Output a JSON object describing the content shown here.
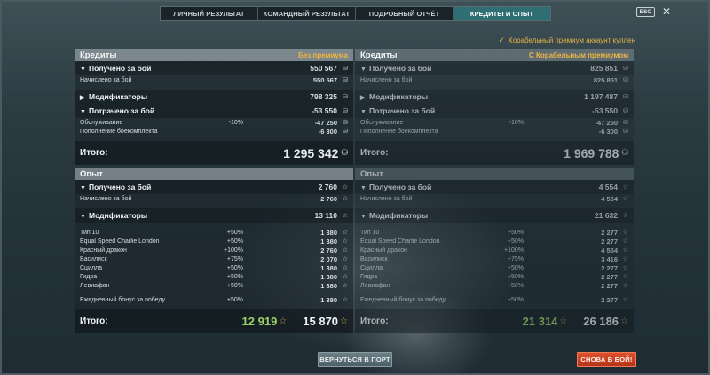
{
  "tabs": [
    {
      "label": "ЛИЧНЫЙ РЕЗУЛЬТАТ",
      "active": false
    },
    {
      "label": "КОМАНДНЫЙ РЕЗУЛЬТАТ",
      "active": false
    },
    {
      "label": "ПОДРОБНЫЙ ОТЧЁТ",
      "active": false
    },
    {
      "label": "КРЕДИТЫ И ОПЫТ",
      "active": true
    }
  ],
  "esc_label": "ESC",
  "premium_note": "Корабельный премиум аккаунт куплен",
  "left": {
    "credits_title": "Кредиты",
    "credits_badge": "Без премиума",
    "earned_label": "Получено за бой",
    "earned_value": "550 567",
    "accrued_label": "Начислено за бой",
    "accrued_value": "550 567",
    "modifiers_label": "Модификаторы",
    "modifiers_value": "798 325",
    "spent_label": "Потрачено за бой",
    "spent_value": "-53 550",
    "service_label": "Обслуживание",
    "service_pct": "-10%",
    "service_value": "-47 250",
    "ammo_label": "Пополнение боекомплекта",
    "ammo_value": "-6 300",
    "total_label": "Итого:",
    "total_value": "1 295 342",
    "xp_title": "Опыт",
    "xp_earned_label": "Получено за бой",
    "xp_earned_value": "2 760",
    "xp_accrued_label": "Начислено за бой",
    "xp_accrued_value": "2 760",
    "xp_mod_label": "Модификаторы",
    "xp_mod_value": "13 110",
    "xp_items": [
      {
        "name": "Тип 10",
        "pct": "+50%",
        "value": "1 380"
      },
      {
        "name": "Equal Speed Charlie London",
        "pct": "+50%",
        "value": "1 380"
      },
      {
        "name": "Красный дракон",
        "pct": "+100%",
        "value": "2 760"
      },
      {
        "name": "Василиск",
        "pct": "+75%",
        "value": "2 070"
      },
      {
        "name": "Сцилла",
        "pct": "+50%",
        "value": "1 380"
      },
      {
        "name": "Гидра",
        "pct": "+50%",
        "value": "1 380"
      },
      {
        "name": "Левиафан",
        "pct": "+50%",
        "value": "1 380"
      }
    ],
    "daily_label": "Ежедневный бонус за победу",
    "daily_pct": "+50%",
    "daily_value": "1 380",
    "xp_total_label": "Итого:",
    "xp_total_free": "12 919",
    "xp_total": "15 870"
  },
  "right": {
    "credits_title": "Кредиты",
    "credits_badge": "С Корабельным премиумом",
    "earned_label": "Получено за бой",
    "earned_value": "825 851",
    "accrued_label": "Начислено за бой",
    "accrued_value": "825 851",
    "modifiers_label": "Модификаторы",
    "modifiers_value": "1 197 487",
    "spent_label": "Потрачено за бой",
    "spent_value": "-53 550",
    "service_label": "Обслуживание",
    "service_pct": "-10%",
    "service_value": "-47 250",
    "ammo_label": "Пополнение боекомплекта",
    "ammo_value": "-6 300",
    "total_label": "Итого:",
    "total_value": "1 969 788",
    "xp_title": "Опыт",
    "xp_earned_label": "Получено за бой",
    "xp_earned_value": "4 554",
    "xp_accrued_label": "Начислено за бой",
    "xp_accrued_value": "4 554",
    "xp_mod_label": "Модификаторы",
    "xp_mod_value": "21 632",
    "xp_items": [
      {
        "name": "Тип 10",
        "pct": "+50%",
        "value": "2 277"
      },
      {
        "name": "Equal Speed Charlie London",
        "pct": "+50%",
        "value": "2 277"
      },
      {
        "name": "Красный дракон",
        "pct": "+100%",
        "value": "4 554"
      },
      {
        "name": "Василиск",
        "pct": "+75%",
        "value": "3 416"
      },
      {
        "name": "Сцилла",
        "pct": "+50%",
        "value": "2 277"
      },
      {
        "name": "Гидра",
        "pct": "+50%",
        "value": "2 277"
      },
      {
        "name": "Левиафан",
        "pct": "+50%",
        "value": "2 277"
      }
    ],
    "daily_label": "Ежедневный бонус за победу",
    "daily_pct": "+50%",
    "daily_value": "2 277",
    "xp_total_label": "Итого:",
    "xp_total_free": "21 314",
    "xp_total": "26 186"
  },
  "buttons": {
    "port": "ВЕРНУТЬСЯ В ПОРТ",
    "battle": "СНОВА В БОЙ!"
  },
  "icons": {
    "credit": "coin-icon",
    "xp": "star-icon",
    "check": "check-icon",
    "close": "close-icon"
  },
  "colors": {
    "active_tab": "#2f6f73",
    "premium": "#f0b440",
    "free_xp": "#9bd26a",
    "battle_button": "#d0442a"
  }
}
